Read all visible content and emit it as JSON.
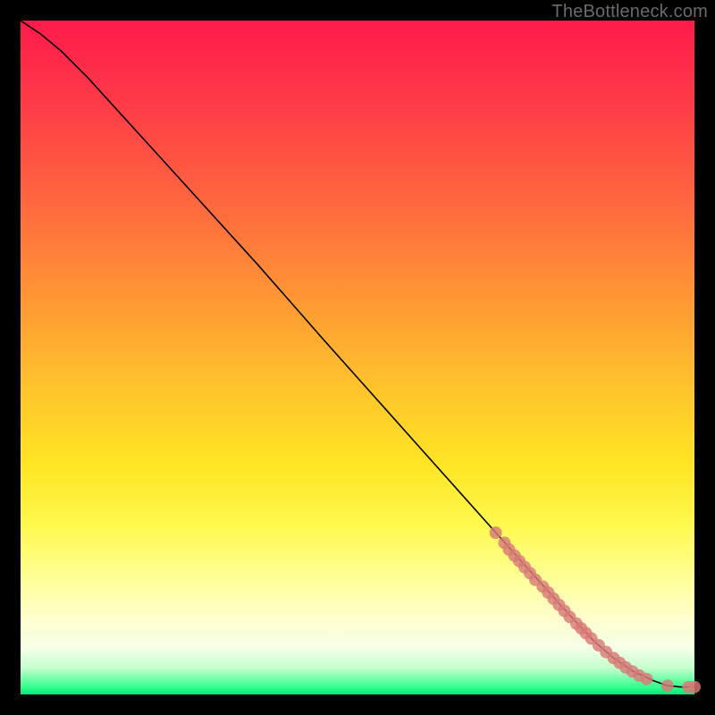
{
  "watermark": "TheBottleneck.com",
  "chart_data": {
    "type": "line",
    "title": "",
    "xlabel": "",
    "ylabel": "",
    "xlim": [
      0,
      100
    ],
    "ylim": [
      0,
      100
    ],
    "grid": false,
    "legend": false,
    "series": [
      {
        "name": "curve",
        "style": "line",
        "color": "#000000",
        "x": [
          0,
          3,
          6,
          10,
          15,
          20,
          25,
          30,
          35,
          40,
          45,
          50,
          55,
          60,
          65,
          70,
          75,
          80,
          85,
          88,
          91,
          94,
          96,
          98,
          100
        ],
        "y": [
          100,
          98,
          95.5,
          91.5,
          86,
          80.5,
          75,
          69.5,
          64,
          58.3,
          52.6,
          47,
          41.4,
          35.8,
          30.2,
          24.6,
          19,
          13.4,
          8,
          5.4,
          3.4,
          2.0,
          1.3,
          1.1,
          1.1
        ]
      },
      {
        "name": "points",
        "style": "scatter",
        "color": "#d87a77",
        "x": [
          70.5,
          71.8,
          72.5,
          73.3,
          74.0,
          74.8,
          75.6,
          76.4,
          77.5,
          78.3,
          79.1,
          79.9,
          80.7,
          81.5,
          82.5,
          83.2,
          83.9,
          84.7,
          85.8,
          86.9,
          88.0,
          88.9,
          89.8,
          90.8,
          91.8,
          92.9,
          96.0,
          99.1,
          100.0
        ],
        "y": [
          24.0,
          22.5,
          21.5,
          20.6,
          19.8,
          18.9,
          18.0,
          17.0,
          16.0,
          15.1,
          14.2,
          13.3,
          12.4,
          11.5,
          10.5,
          9.8,
          9.1,
          8.3,
          7.3,
          6.3,
          5.4,
          4.7,
          4.0,
          3.4,
          2.8,
          2.3,
          1.3,
          1.1,
          1.1
        ]
      }
    ]
  }
}
